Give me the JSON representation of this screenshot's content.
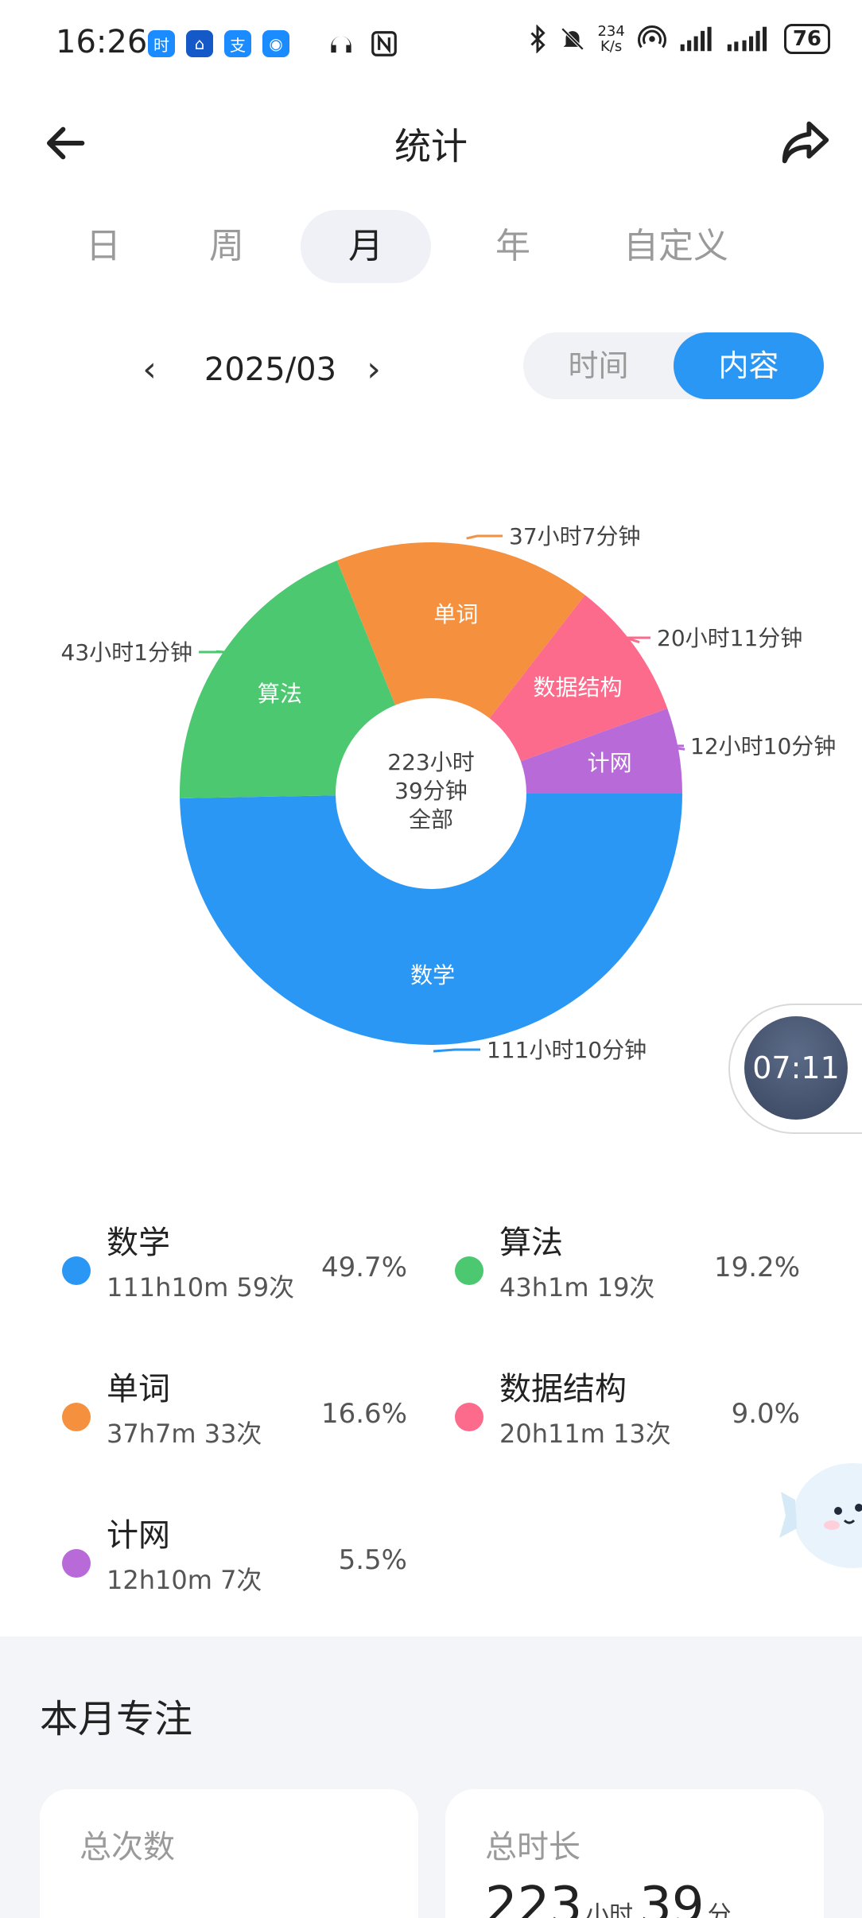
{
  "status_bar": {
    "time": "16:26",
    "apps": [
      "时",
      "⌂",
      "支",
      "◉"
    ],
    "speed_top": "234",
    "speed_bottom": "K/s",
    "battery": "76"
  },
  "header": {
    "title": "统计"
  },
  "tabs": [
    "日",
    "周",
    "月",
    "年",
    "自定义"
  ],
  "active_tab": "月",
  "date_nav": {
    "label": "2025/03",
    "prev": "‹",
    "next": "›"
  },
  "toggle": {
    "left": "时间",
    "right": "内容",
    "selected": "内容"
  },
  "chart_data": {
    "type": "pie",
    "donut": true,
    "center_lines": [
      "223小时",
      "39分钟",
      "全部"
    ],
    "slices": [
      {
        "name": "数学",
        "value_label": "111小时10分钟",
        "percent": 49.7,
        "color": "#2b97f5"
      },
      {
        "name": "算法",
        "value_label": "43小时1分钟",
        "percent": 19.2,
        "color": "#4cc870"
      },
      {
        "name": "单词",
        "value_label": "37小时7分钟",
        "percent": 16.6,
        "color": "#f5913e"
      },
      {
        "name": "数据结构",
        "value_label": "20小时11分钟",
        "percent": 9.0,
        "color": "#fc6b8c"
      },
      {
        "name": "计网",
        "value_label": "12小时10分钟",
        "percent": 5.5,
        "color": "#b86ad8"
      }
    ]
  },
  "timer": {
    "label": "07:11"
  },
  "legend": [
    {
      "name": "数学",
      "sub": "111h10m  59次",
      "pct": "49.7%",
      "color": "#2b97f5"
    },
    {
      "name": "算法",
      "sub": "43h1m  19次",
      "pct": "19.2%",
      "color": "#4cc870"
    },
    {
      "name": "单词",
      "sub": "37h7m  33次",
      "pct": "16.6%",
      "color": "#f5913e"
    },
    {
      "name": "数据结构",
      "sub": "20h11m  13次",
      "pct": "9.0%",
      "color": "#fc6b8c"
    },
    {
      "name": "计网",
      "sub": "12h10m  7次",
      "pct": "5.5%",
      "color": "#b86ad8"
    }
  ],
  "bottom": {
    "title": "本月专注",
    "card_count_label": "总次数",
    "card_duration_label": "总时长",
    "duration_hours": "223",
    "duration_hours_unit": "小时",
    "duration_minutes": "39",
    "duration_minutes_unit": "分"
  }
}
